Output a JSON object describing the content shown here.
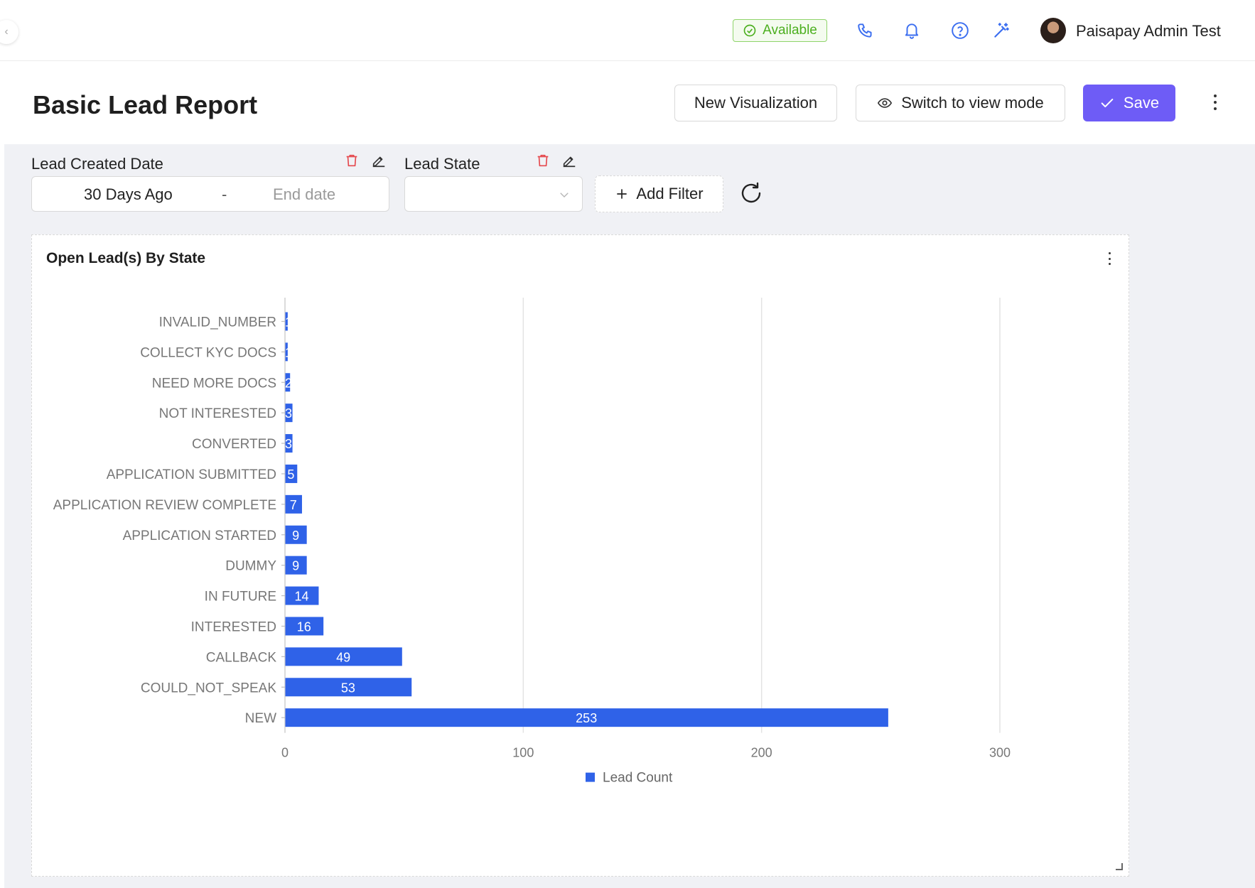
{
  "topbar": {
    "status_label": "Available",
    "user_name": "Paisapay Admin Test",
    "icons": [
      "phone-icon",
      "bell-icon",
      "help-icon",
      "magic-wand-icon"
    ]
  },
  "header": {
    "title": "Basic Lead Report",
    "new_visualization_label": "New Visualization",
    "switch_view_label": "Switch to view mode",
    "save_label": "Save"
  },
  "filters": {
    "created_date": {
      "label": "Lead Created Date",
      "start_value": "30 Days Ago",
      "separator": "-",
      "end_placeholder": "End date"
    },
    "lead_state": {
      "label": "Lead State",
      "value": ""
    },
    "add_filter_label": "Add Filter"
  },
  "colors": {
    "accent": "#6e5cf6",
    "bar": "#2f62e8",
    "available": "#4caf1f",
    "delete": "#e5484d"
  },
  "card": {
    "title": "Open Lead(s) By State"
  },
  "chart_data": {
    "type": "bar",
    "orientation": "horizontal",
    "categories": [
      "INVALID_NUMBER",
      "COLLECT KYC DOCS",
      "NEED MORE DOCS",
      "NOT INTERESTED",
      "CONVERTED",
      "APPLICATION SUBMITTED",
      "APPLICATION REVIEW COMPLETE",
      "APPLICATION STARTED",
      "DUMMY",
      "IN FUTURE",
      "INTERESTED",
      "CALLBACK",
      "COULD_NOT_SPEAK",
      "NEW"
    ],
    "series": [
      {
        "name": "Lead Count",
        "values": [
          1,
          1,
          2,
          3,
          3,
          5,
          7,
          9,
          9,
          14,
          16,
          49,
          53,
          253
        ]
      }
    ],
    "data_labels": [
      "1",
      "1",
      "2",
      "3",
      "3",
      "5",
      "7",
      "9",
      "9",
      "14",
      "16",
      "49",
      "53",
      "253"
    ],
    "x_ticks": [
      "0",
      "100",
      "200",
      "300"
    ],
    "xlim": [
      0,
      300
    ],
    "grid": "vertical",
    "legend": "bottom-center"
  }
}
